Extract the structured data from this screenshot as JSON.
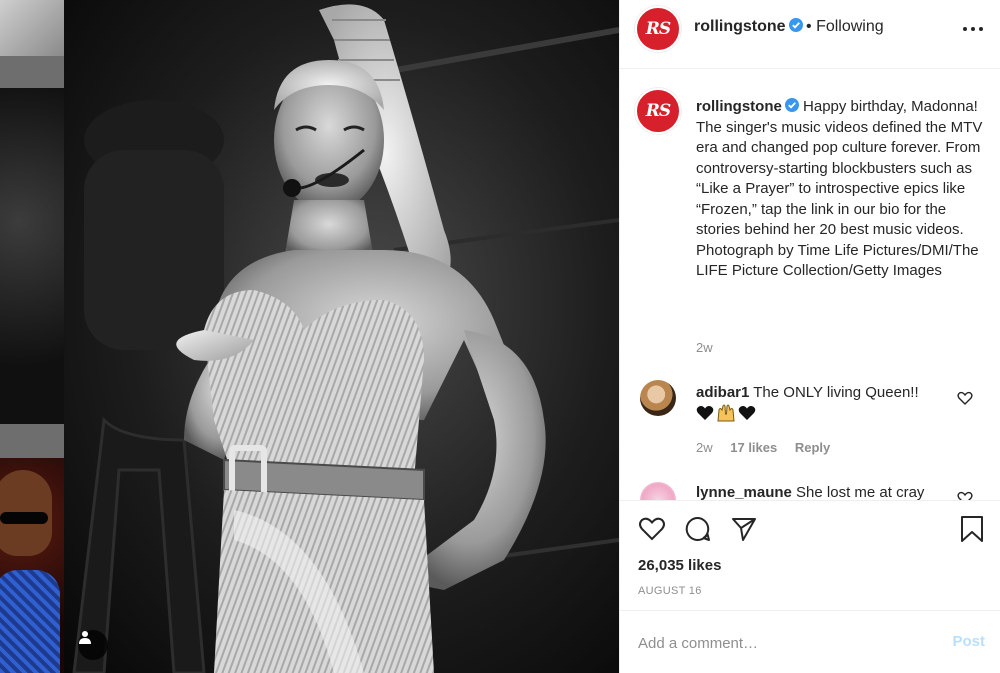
{
  "post": {
    "username": "rollingstone",
    "logo_text": "RS",
    "follow_sep": "•",
    "follow_label": "Following",
    "caption_text": "Happy birthday, Madonna! The singer's music videos defined the MTV era and changed pop culture forever. From controversy-starting blockbusters such as “Like a Prayer” to introspective epics like “Frozen,” tap the link in our bio for the stories behind her 20 best music videos. Photograph by Time Life Pictures/DMI/The LIFE Picture Collection/Getty Images",
    "caption_time": "2w",
    "likes": "26,035 likes",
    "date": "AUGUST 16",
    "comment_placeholder": "Add a comment…",
    "post_label": "Post"
  },
  "comments": [
    {
      "username": "adibar1",
      "text": "The ONLY living Queen!!",
      "emojis": [
        "black-heart",
        "raising-hands",
        "black-heart"
      ],
      "time": "2w",
      "likes": "17 likes",
      "reply": "Reply"
    },
    {
      "username": "lynne_maune",
      "text": "She lost me at cray"
    }
  ],
  "colors": {
    "brand_red": "#d6202b",
    "verified_blue": "#3897f0",
    "muted_text": "#8e8e8e",
    "post_disabled": "#b9dffc"
  }
}
